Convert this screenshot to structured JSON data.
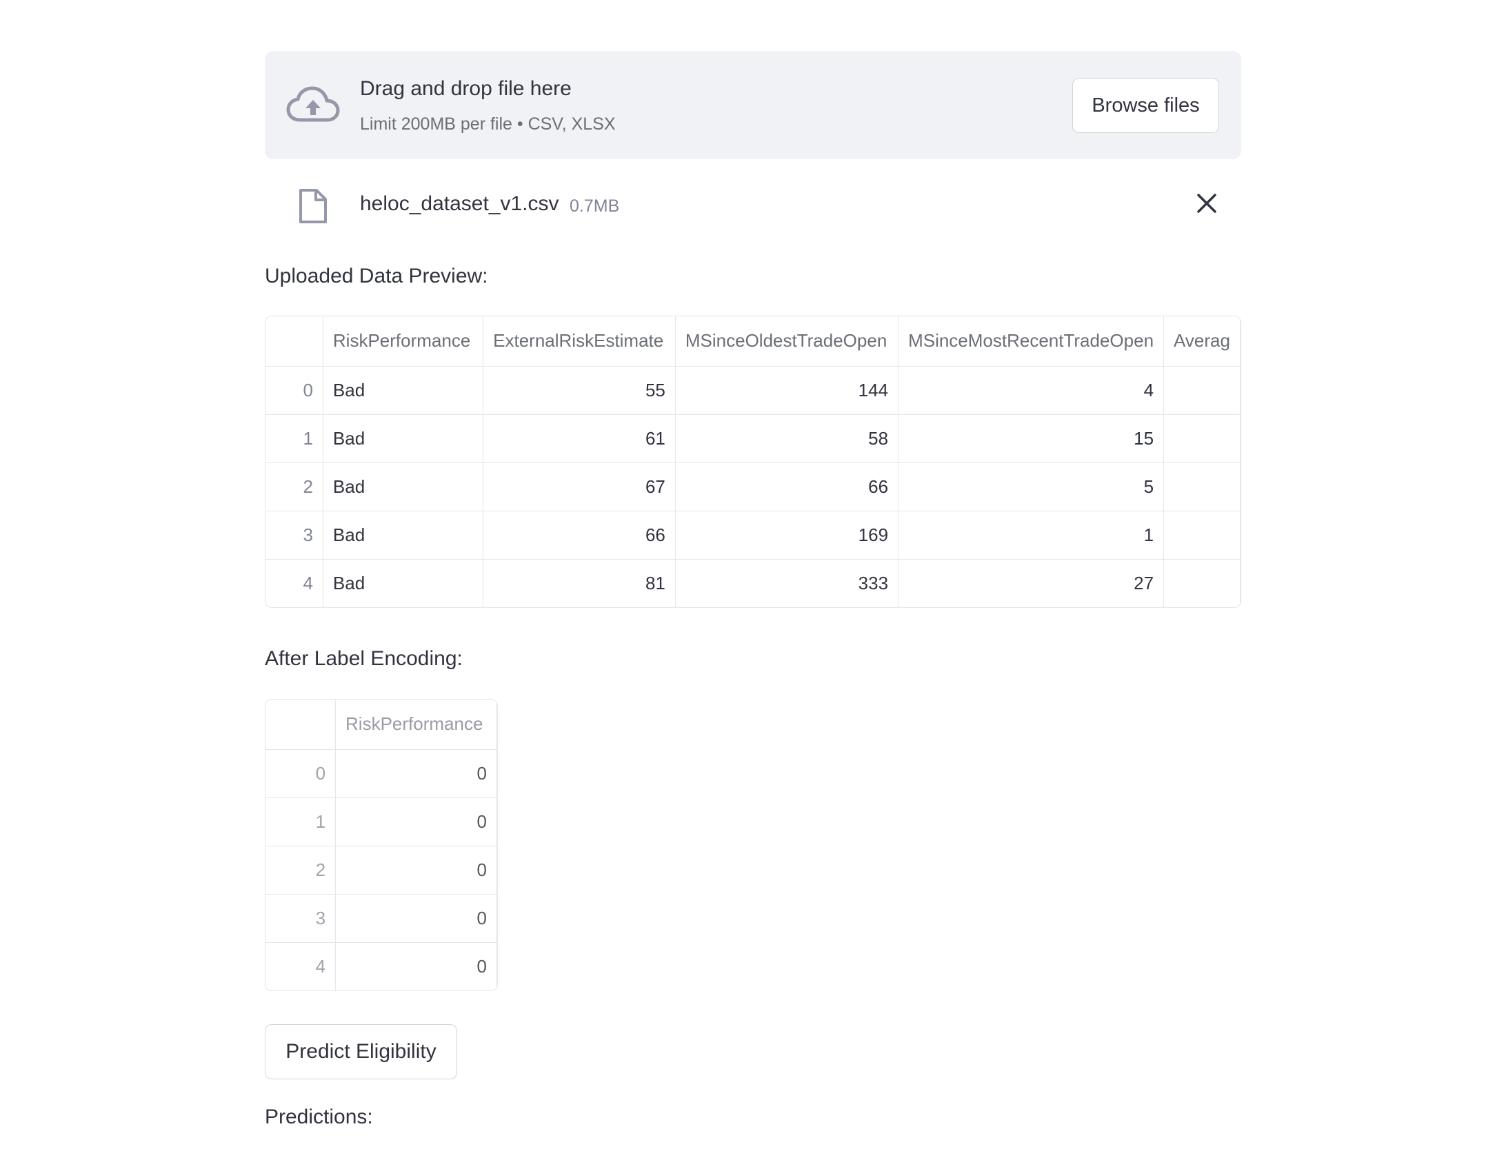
{
  "uploader": {
    "title": "Drag and drop file here",
    "subtitle": "Limit 200MB per file • CSV, XLSX",
    "browse_label": "Browse files",
    "icon": "cloud-upload-icon"
  },
  "file": {
    "name": "heloc_dataset_v1.csv",
    "size": "0.7MB",
    "icon": "file-icon",
    "remove_icon": "close-icon"
  },
  "preview": {
    "label": "Uploaded Data Preview:",
    "columns": [
      "",
      "RiskPerformance",
      "ExternalRiskEstimate",
      "MSinceOldestTradeOpen",
      "MSinceMostRecentTradeOpen",
      "Averag"
    ],
    "rows": [
      {
        "index": "0",
        "RiskPerformance": "Bad",
        "ExternalRiskEstimate": "55",
        "MSinceOldestTradeOpen": "144",
        "MSinceMostRecentTradeOpen": "4"
      },
      {
        "index": "1",
        "RiskPerformance": "Bad",
        "ExternalRiskEstimate": "61",
        "MSinceOldestTradeOpen": "58",
        "MSinceMostRecentTradeOpen": "15"
      },
      {
        "index": "2",
        "RiskPerformance": "Bad",
        "ExternalRiskEstimate": "67",
        "MSinceOldestTradeOpen": "66",
        "MSinceMostRecentTradeOpen": "5"
      },
      {
        "index": "3",
        "RiskPerformance": "Bad",
        "ExternalRiskEstimate": "66",
        "MSinceOldestTradeOpen": "169",
        "MSinceMostRecentTradeOpen": "1"
      },
      {
        "index": "4",
        "RiskPerformance": "Bad",
        "ExternalRiskEstimate": "81",
        "MSinceOldestTradeOpen": "333",
        "MSinceMostRecentTradeOpen": "27"
      }
    ]
  },
  "encoded": {
    "label": "After Label Encoding:",
    "columns": [
      "",
      "RiskPerformance"
    ],
    "rows": [
      {
        "index": "0",
        "RiskPerformance": "0"
      },
      {
        "index": "1",
        "RiskPerformance": "0"
      },
      {
        "index": "2",
        "RiskPerformance": "0"
      },
      {
        "index": "3",
        "RiskPerformance": "0"
      },
      {
        "index": "4",
        "RiskPerformance": "0"
      }
    ]
  },
  "predict": {
    "button_label": "Predict Eligibility",
    "result_label": "Predictions:"
  }
}
